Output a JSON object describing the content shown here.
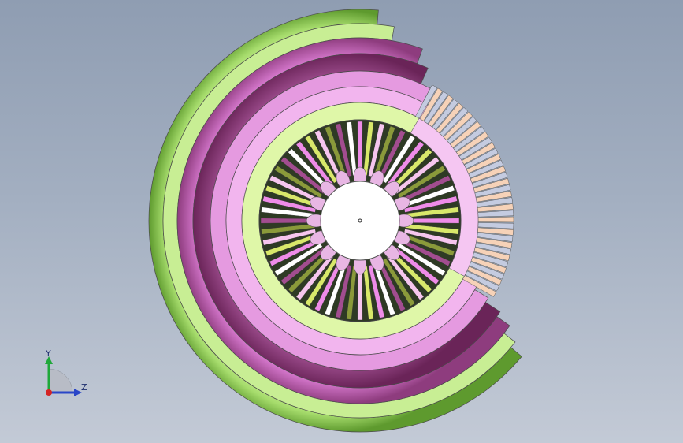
{
  "viewport": {
    "background_top": "#8f9db2",
    "background_bottom": "#c3cad6"
  },
  "model": {
    "colors": {
      "green": "#a6dc6c",
      "light_green": "#dff7a8",
      "pink": "#ee8ce8",
      "dark_pink": "#a24d8f",
      "peach": "#f6d2b8",
      "steel": "#c4cbe0",
      "hub": "#ffffff"
    },
    "spoke_count": 56,
    "blade_count": 38
  },
  "triad": {
    "y_label": "Y",
    "z_label": "Z"
  }
}
